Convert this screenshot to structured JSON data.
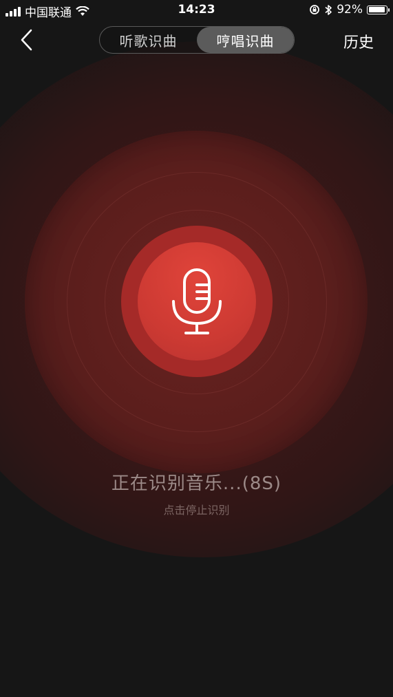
{
  "status_bar": {
    "carrier": "中国联通",
    "time": "14:23",
    "battery_percent": "92%",
    "battery_level": 0.92
  },
  "header": {
    "back_icon": "chevron-left-icon",
    "tabs": [
      {
        "label": "听歌识曲",
        "active": false
      },
      {
        "label": "哼唱识曲",
        "active": true
      }
    ],
    "history_label": "历史"
  },
  "recognition": {
    "status_text": "正在识别音乐...(8S)",
    "hint_text": "点击停止识别",
    "mic_icon": "microphone-icon"
  },
  "colors": {
    "background": "#161616",
    "accent": "#d63b34",
    "segment_active": "#5b5b5b"
  }
}
